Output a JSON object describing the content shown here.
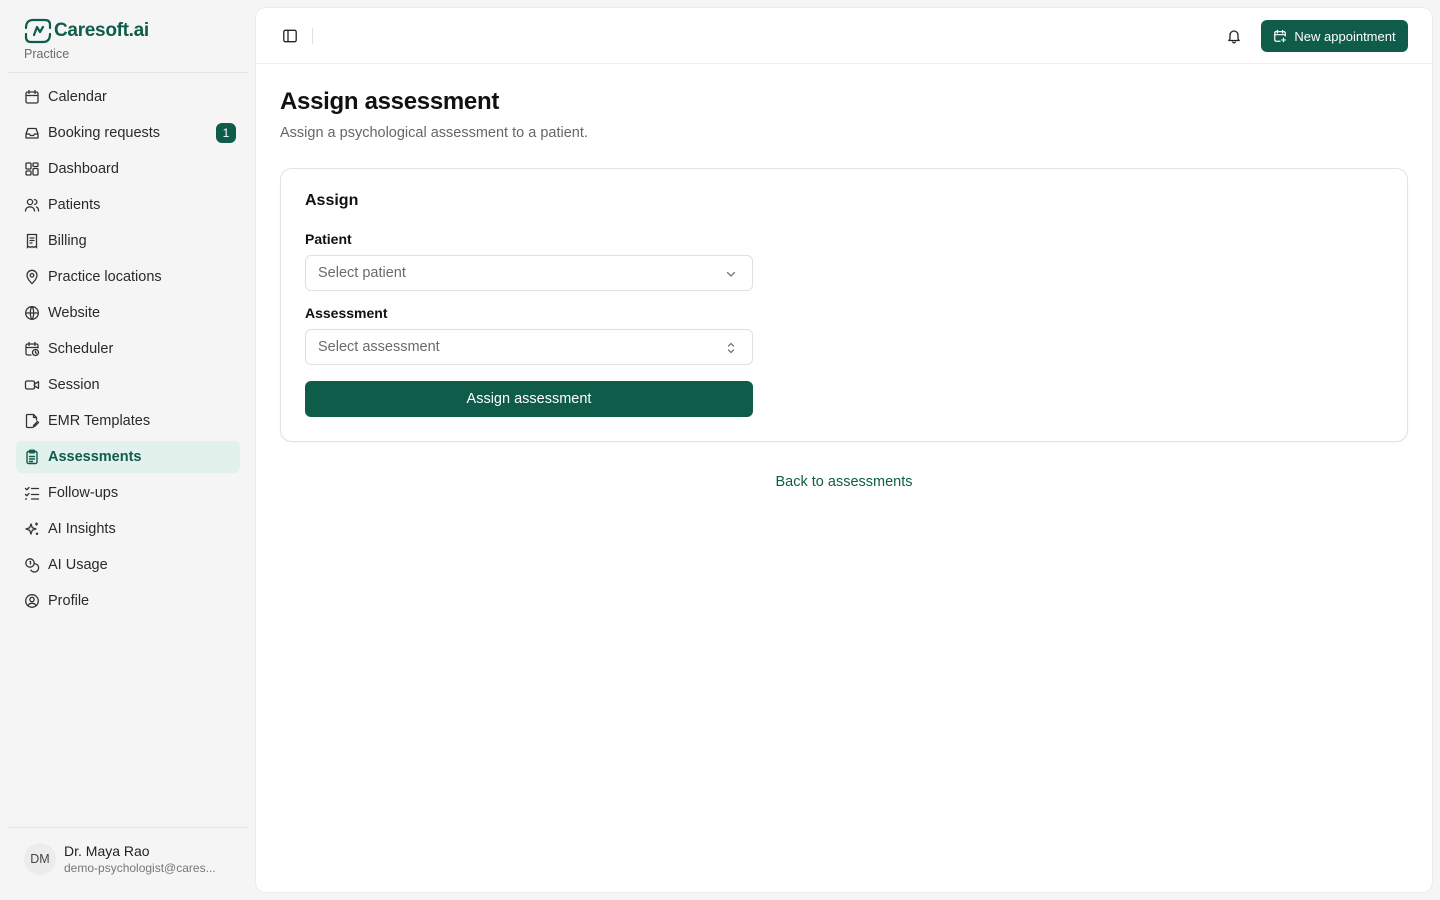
{
  "brand": {
    "name": "Caresoft.ai",
    "subtitle": "Practice",
    "color": "#0f5c4a"
  },
  "sidebar": {
    "items": [
      {
        "label": "Calendar",
        "icon": "calendar-icon"
      },
      {
        "label": "Booking requests",
        "icon": "inbox-icon",
        "badge": "1"
      },
      {
        "label": "Dashboard",
        "icon": "dashboard-icon"
      },
      {
        "label": "Patients",
        "icon": "users-icon"
      },
      {
        "label": "Billing",
        "icon": "receipt-icon"
      },
      {
        "label": "Practice locations",
        "icon": "map-pin-icon"
      },
      {
        "label": "Website",
        "icon": "globe-icon"
      },
      {
        "label": "Scheduler",
        "icon": "calendar-clock-icon"
      },
      {
        "label": "Session",
        "icon": "video-icon"
      },
      {
        "label": "EMR Templates",
        "icon": "file-edit-icon"
      },
      {
        "label": "Assessments",
        "icon": "clipboard-icon",
        "active": true
      },
      {
        "label": "Follow-ups",
        "icon": "list-checks-icon"
      },
      {
        "label": "AI Insights",
        "icon": "sparkles-icon"
      },
      {
        "label": "AI Usage",
        "icon": "coins-icon"
      },
      {
        "label": "Profile",
        "icon": "user-circle-icon"
      }
    ]
  },
  "user": {
    "initials": "DM",
    "name": "Dr. Maya Rao",
    "email": "demo-psychologist@cares..."
  },
  "topbar": {
    "new_appointment_label": "New appointment"
  },
  "page": {
    "title": "Assign assessment",
    "subtitle": "Assign a psychological assessment to a patient."
  },
  "form": {
    "card_title": "Assign",
    "patient_label": "Patient",
    "patient_placeholder": "Select patient",
    "assessment_label": "Assessment",
    "assessment_placeholder": "Select assessment",
    "submit_label": "Assign assessment"
  },
  "back_link": "Back to assessments"
}
